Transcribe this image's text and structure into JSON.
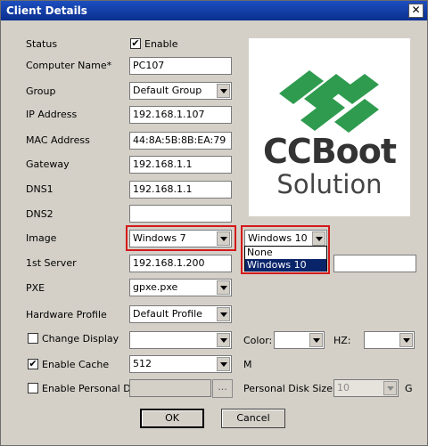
{
  "window": {
    "title": "Client Details",
    "close_glyph": "✕"
  },
  "labels": {
    "status": "Status",
    "computer_name": "Computer Name*",
    "group": "Group",
    "ip_address": "IP Address",
    "mac_address": "MAC Address",
    "gateway": "Gateway",
    "dns1": "DNS1",
    "dns2": "DNS2",
    "image": "Image",
    "first_server": "1st Server",
    "pxe": "PXE",
    "hardware_profile": "Hardware Profile",
    "change_display": "Change Display",
    "enable_cache": "Enable Cache",
    "enable_personal_disk": "Enable Personal Disk",
    "color": "Color:",
    "hz": "HZ:",
    "m_unit": "M",
    "personal_disk_size": "Personal Disk Size",
    "g_unit": "G"
  },
  "checkboxes": {
    "enable_label": "Enable",
    "enable_checked": true,
    "change_display_checked": false,
    "enable_cache_checked": true,
    "enable_personal_disk_checked": false,
    "check_glyph": "✔"
  },
  "fields": {
    "computer_name": "PC107",
    "group": "Default Group",
    "ip_address": "192.168.1.107",
    "mac_address": "44:8A:5B:8B:EA:79",
    "gateway": "192.168.1.1",
    "dns1": "192.168.1.1",
    "dns2": "",
    "image": "Windows 7",
    "image2": "Windows 10",
    "first_server": "192.168.1.200",
    "second_server": "",
    "pxe": "gpxe.pxe",
    "hardware_profile": "Default Profile",
    "change_display": "",
    "color": "",
    "hz": "",
    "cache_size": "512",
    "personal_disk_path": "",
    "personal_disk_size": "10",
    "browse_label": "..."
  },
  "image2_options": [
    "None",
    "Windows 10"
  ],
  "image2_selected": "Windows 10",
  "logo": {
    "line1": "CCBoot",
    "line2": "Solution",
    "color": "#2e9b4e"
  },
  "buttons": {
    "ok": "OK",
    "cancel": "Cancel"
  },
  "colors": {
    "highlight": "#d41a1a",
    "title_bar": "#0a2f8e",
    "selection": "#0a246a"
  }
}
